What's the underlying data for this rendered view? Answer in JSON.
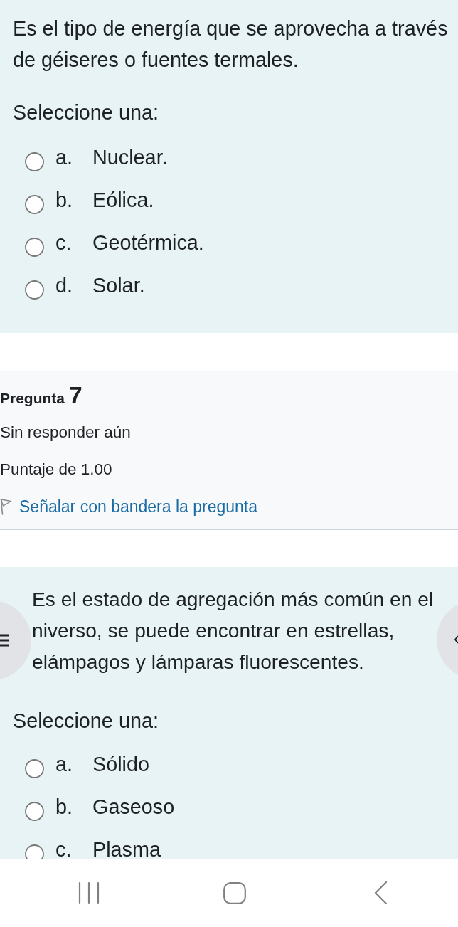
{
  "previous_question": {
    "text_lines": [
      "Es el tipo de energía que se aprovecha a través",
      "de géiseres o fuentes termales."
    ],
    "prompt": "Seleccione una:",
    "options": [
      {
        "letter": "a.",
        "text": "Nuclear.",
        "selected": false
      },
      {
        "letter": "b.",
        "text": "Eólica.",
        "selected": false
      },
      {
        "letter": "c.",
        "text": "Geotérmica.",
        "selected": false
      },
      {
        "letter": "d.",
        "text": "Solar.",
        "selected": false
      }
    ]
  },
  "question_info": {
    "title": "Pregunta",
    "number": "7",
    "status": "Sin responder aún",
    "grade": "Puntaje de 1.00",
    "flag_link": "Señalar con bandera la pregunta",
    "flagged": false
  },
  "question": {
    "text_lines": [
      "Es el estado de agregación más común en el",
      "niverso, se puede encontrar en estrellas,",
      "elámpagos y lámparas fluorescentes."
    ],
    "prompt": "Seleccione una:",
    "options": [
      {
        "letter": "a.",
        "text": "Sólido",
        "selected": false
      },
      {
        "letter": "b.",
        "text": "Gaseoso",
        "selected": false
      },
      {
        "letter": "c.",
        "text": "Plasma",
        "selected": false
      }
    ]
  }
}
